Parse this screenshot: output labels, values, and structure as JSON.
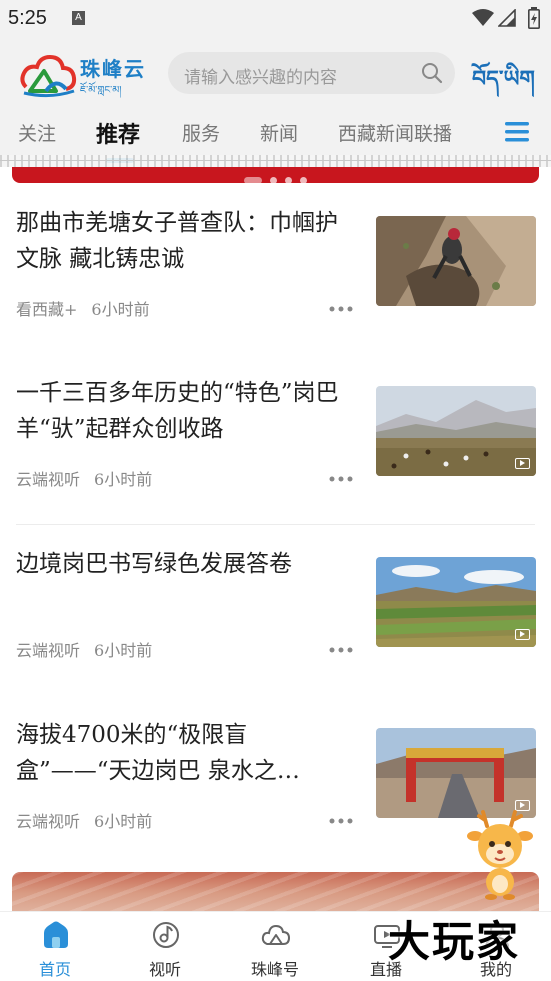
{
  "status": {
    "time": "5:25",
    "sim_label": "A"
  },
  "header": {
    "brand": "珠峰云",
    "brand_tibetan": "ཇོ་མོ་གླང་མ།",
    "search_placeholder": "请输入感兴趣的内容",
    "language_label": "བོད་ཡིག"
  },
  "tabs": [
    {
      "label": "关注",
      "active": false
    },
    {
      "label": "推荐",
      "active": true
    },
    {
      "label": "服务",
      "active": false
    },
    {
      "label": "新闻",
      "active": false
    },
    {
      "label": "西藏新闻联播",
      "active": false
    }
  ],
  "news": [
    {
      "title": "那曲市羌塘女子普查队：巾帼护文脉 藏北铸忠诚",
      "source": "看西藏+",
      "time": "6小时前",
      "is_video": false,
      "thumb_icon": "cliff-climber-photo"
    },
    {
      "title": "一千三百多年历史的“特色”岗巴羊“驮”起群众创收路",
      "source": "云端视听",
      "time": "6小时前",
      "is_video": true,
      "thumb_icon": "grassland-sheep-photo"
    },
    {
      "title": "边境岗巴书写绿色发展答卷",
      "source": "云端视听",
      "time": "6小时前",
      "is_video": true,
      "thumb_icon": "farmland-landscape-photo"
    },
    {
      "title": "海拔4700米的“极限盲盒”——“天边岗巴 泉水之…",
      "source": "云端视听",
      "time": "6小时前",
      "is_video": true,
      "thumb_icon": "highway-gate-photo"
    }
  ],
  "bottom_nav": [
    {
      "label": "首页",
      "active": true
    },
    {
      "label": "视听",
      "active": false
    },
    {
      "label": "珠峰号",
      "active": false
    },
    {
      "label": "直播",
      "active": false
    },
    {
      "label": "我的",
      "active": false
    }
  ],
  "watermark": "大玩家",
  "colors": {
    "accent": "#2a8fd8",
    "banner_red": "#c8161e",
    "brand_blue": "#1e7fc6"
  }
}
